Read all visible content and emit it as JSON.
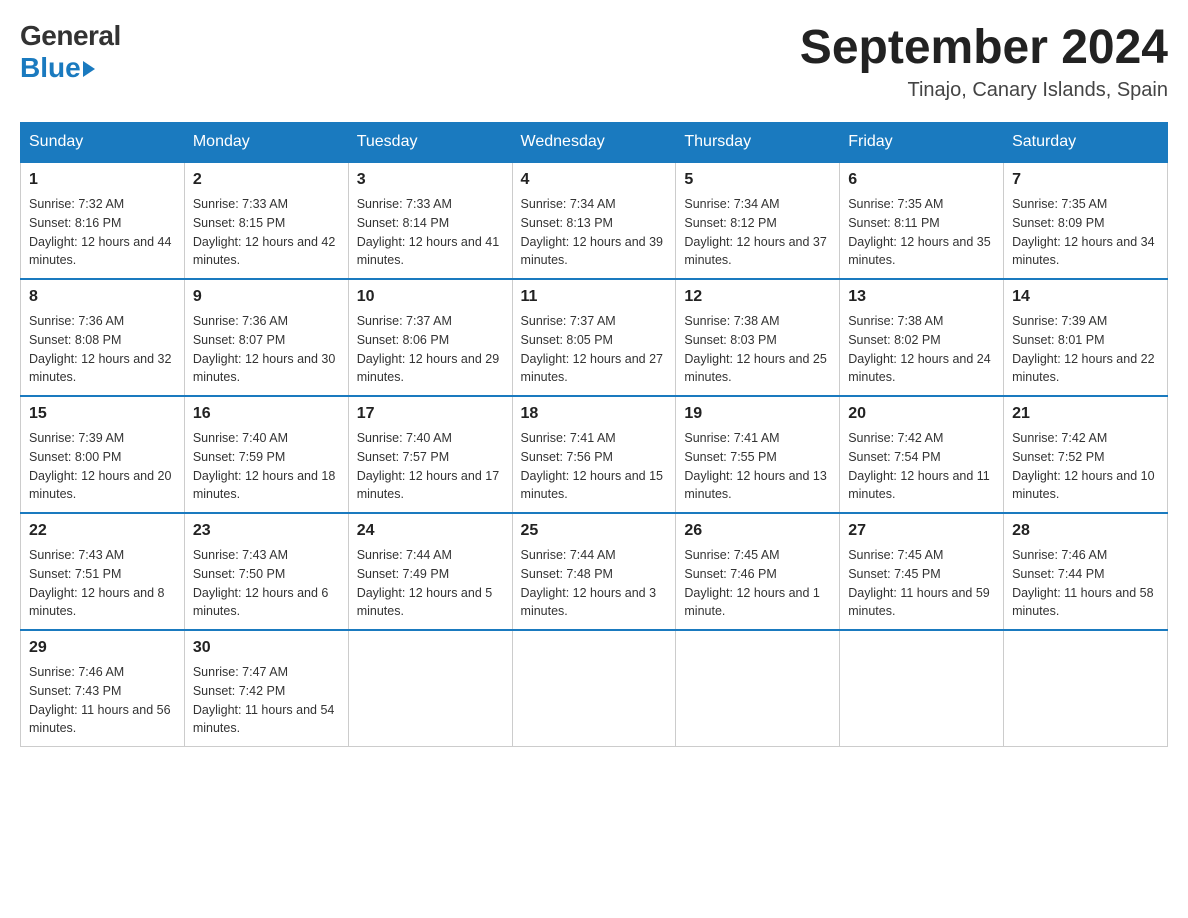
{
  "header": {
    "logo_general": "General",
    "logo_blue": "Blue",
    "month_title": "September 2024",
    "location": "Tinajo, Canary Islands, Spain"
  },
  "weekdays": [
    "Sunday",
    "Monday",
    "Tuesday",
    "Wednesday",
    "Thursday",
    "Friday",
    "Saturday"
  ],
  "weeks": [
    [
      {
        "day": "1",
        "sunrise": "Sunrise: 7:32 AM",
        "sunset": "Sunset: 8:16 PM",
        "daylight": "Daylight: 12 hours and 44 minutes."
      },
      {
        "day": "2",
        "sunrise": "Sunrise: 7:33 AM",
        "sunset": "Sunset: 8:15 PM",
        "daylight": "Daylight: 12 hours and 42 minutes."
      },
      {
        "day": "3",
        "sunrise": "Sunrise: 7:33 AM",
        "sunset": "Sunset: 8:14 PM",
        "daylight": "Daylight: 12 hours and 41 minutes."
      },
      {
        "day": "4",
        "sunrise": "Sunrise: 7:34 AM",
        "sunset": "Sunset: 8:13 PM",
        "daylight": "Daylight: 12 hours and 39 minutes."
      },
      {
        "day": "5",
        "sunrise": "Sunrise: 7:34 AM",
        "sunset": "Sunset: 8:12 PM",
        "daylight": "Daylight: 12 hours and 37 minutes."
      },
      {
        "day": "6",
        "sunrise": "Sunrise: 7:35 AM",
        "sunset": "Sunset: 8:11 PM",
        "daylight": "Daylight: 12 hours and 35 minutes."
      },
      {
        "day": "7",
        "sunrise": "Sunrise: 7:35 AM",
        "sunset": "Sunset: 8:09 PM",
        "daylight": "Daylight: 12 hours and 34 minutes."
      }
    ],
    [
      {
        "day": "8",
        "sunrise": "Sunrise: 7:36 AM",
        "sunset": "Sunset: 8:08 PM",
        "daylight": "Daylight: 12 hours and 32 minutes."
      },
      {
        "day": "9",
        "sunrise": "Sunrise: 7:36 AM",
        "sunset": "Sunset: 8:07 PM",
        "daylight": "Daylight: 12 hours and 30 minutes."
      },
      {
        "day": "10",
        "sunrise": "Sunrise: 7:37 AM",
        "sunset": "Sunset: 8:06 PM",
        "daylight": "Daylight: 12 hours and 29 minutes."
      },
      {
        "day": "11",
        "sunrise": "Sunrise: 7:37 AM",
        "sunset": "Sunset: 8:05 PM",
        "daylight": "Daylight: 12 hours and 27 minutes."
      },
      {
        "day": "12",
        "sunrise": "Sunrise: 7:38 AM",
        "sunset": "Sunset: 8:03 PM",
        "daylight": "Daylight: 12 hours and 25 minutes."
      },
      {
        "day": "13",
        "sunrise": "Sunrise: 7:38 AM",
        "sunset": "Sunset: 8:02 PM",
        "daylight": "Daylight: 12 hours and 24 minutes."
      },
      {
        "day": "14",
        "sunrise": "Sunrise: 7:39 AM",
        "sunset": "Sunset: 8:01 PM",
        "daylight": "Daylight: 12 hours and 22 minutes."
      }
    ],
    [
      {
        "day": "15",
        "sunrise": "Sunrise: 7:39 AM",
        "sunset": "Sunset: 8:00 PM",
        "daylight": "Daylight: 12 hours and 20 minutes."
      },
      {
        "day": "16",
        "sunrise": "Sunrise: 7:40 AM",
        "sunset": "Sunset: 7:59 PM",
        "daylight": "Daylight: 12 hours and 18 minutes."
      },
      {
        "day": "17",
        "sunrise": "Sunrise: 7:40 AM",
        "sunset": "Sunset: 7:57 PM",
        "daylight": "Daylight: 12 hours and 17 minutes."
      },
      {
        "day": "18",
        "sunrise": "Sunrise: 7:41 AM",
        "sunset": "Sunset: 7:56 PM",
        "daylight": "Daylight: 12 hours and 15 minutes."
      },
      {
        "day": "19",
        "sunrise": "Sunrise: 7:41 AM",
        "sunset": "Sunset: 7:55 PM",
        "daylight": "Daylight: 12 hours and 13 minutes."
      },
      {
        "day": "20",
        "sunrise": "Sunrise: 7:42 AM",
        "sunset": "Sunset: 7:54 PM",
        "daylight": "Daylight: 12 hours and 11 minutes."
      },
      {
        "day": "21",
        "sunrise": "Sunrise: 7:42 AM",
        "sunset": "Sunset: 7:52 PM",
        "daylight": "Daylight: 12 hours and 10 minutes."
      }
    ],
    [
      {
        "day": "22",
        "sunrise": "Sunrise: 7:43 AM",
        "sunset": "Sunset: 7:51 PM",
        "daylight": "Daylight: 12 hours and 8 minutes."
      },
      {
        "day": "23",
        "sunrise": "Sunrise: 7:43 AM",
        "sunset": "Sunset: 7:50 PM",
        "daylight": "Daylight: 12 hours and 6 minutes."
      },
      {
        "day": "24",
        "sunrise": "Sunrise: 7:44 AM",
        "sunset": "Sunset: 7:49 PM",
        "daylight": "Daylight: 12 hours and 5 minutes."
      },
      {
        "day": "25",
        "sunrise": "Sunrise: 7:44 AM",
        "sunset": "Sunset: 7:48 PM",
        "daylight": "Daylight: 12 hours and 3 minutes."
      },
      {
        "day": "26",
        "sunrise": "Sunrise: 7:45 AM",
        "sunset": "Sunset: 7:46 PM",
        "daylight": "Daylight: 12 hours and 1 minute."
      },
      {
        "day": "27",
        "sunrise": "Sunrise: 7:45 AM",
        "sunset": "Sunset: 7:45 PM",
        "daylight": "Daylight: 11 hours and 59 minutes."
      },
      {
        "day": "28",
        "sunrise": "Sunrise: 7:46 AM",
        "sunset": "Sunset: 7:44 PM",
        "daylight": "Daylight: 11 hours and 58 minutes."
      }
    ],
    [
      {
        "day": "29",
        "sunrise": "Sunrise: 7:46 AM",
        "sunset": "Sunset: 7:43 PM",
        "daylight": "Daylight: 11 hours and 56 minutes."
      },
      {
        "day": "30",
        "sunrise": "Sunrise: 7:47 AM",
        "sunset": "Sunset: 7:42 PM",
        "daylight": "Daylight: 11 hours and 54 minutes."
      },
      null,
      null,
      null,
      null,
      null
    ]
  ]
}
